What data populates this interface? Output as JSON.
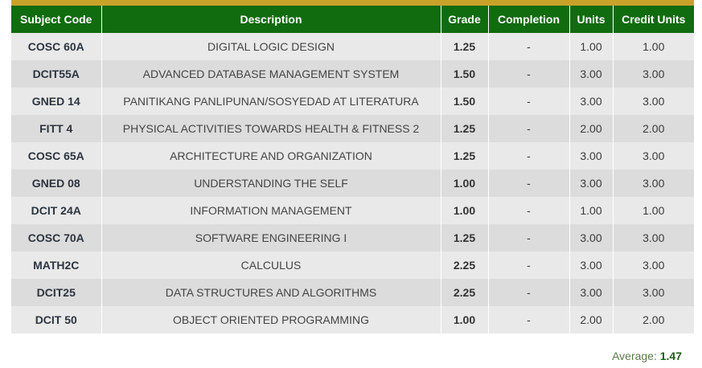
{
  "table": {
    "headers": {
      "subject_code": "Subject Code",
      "description": "Description",
      "grade": "Grade",
      "completion": "Completion",
      "units": "Units",
      "credit_units": "Credit Units"
    },
    "rows": [
      {
        "code": "COSC 60A",
        "description": "DIGITAL LOGIC DESIGN",
        "grade": "1.25",
        "completion": "-",
        "units": "1.00",
        "credit_units": "1.00"
      },
      {
        "code": "DCIT55A",
        "description": "ADVANCED DATABASE MANAGEMENT SYSTEM",
        "grade": "1.50",
        "completion": "-",
        "units": "3.00",
        "credit_units": "3.00"
      },
      {
        "code": "GNED 14",
        "description": "PANITIKANG PANLIPUNAN/SOSYEDAD AT LITERATURA",
        "grade": "1.50",
        "completion": "-",
        "units": "3.00",
        "credit_units": "3.00"
      },
      {
        "code": "FITT 4",
        "description": "PHYSICAL ACTIVITIES TOWARDS HEALTH & FITNESS 2",
        "grade": "1.25",
        "completion": "-",
        "units": "2.00",
        "credit_units": "2.00"
      },
      {
        "code": "COSC 65A",
        "description": "ARCHITECTURE AND ORGANIZATION",
        "grade": "1.25",
        "completion": "-",
        "units": "3.00",
        "credit_units": "3.00"
      },
      {
        "code": "GNED 08",
        "description": "UNDERSTANDING THE SELF",
        "grade": "1.00",
        "completion": "-",
        "units": "3.00",
        "credit_units": "3.00"
      },
      {
        "code": "DCIT 24A",
        "description": "INFORMATION MANAGEMENT",
        "grade": "1.00",
        "completion": "-",
        "units": "1.00",
        "credit_units": "1.00"
      },
      {
        "code": "COSC 70A",
        "description": "SOFTWARE ENGINEERING I",
        "grade": "1.25",
        "completion": "-",
        "units": "3.00",
        "credit_units": "3.00"
      },
      {
        "code": "MATH2C",
        "description": "CALCULUS",
        "grade": "2.25",
        "completion": "-",
        "units": "3.00",
        "credit_units": "3.00"
      },
      {
        "code": "DCIT25",
        "description": "DATA STRUCTURES AND ALGORITHMS",
        "grade": "2.25",
        "completion": "-",
        "units": "3.00",
        "credit_units": "3.00"
      },
      {
        "code": "DCIT 50",
        "description": "OBJECT ORIENTED PROGRAMMING",
        "grade": "1.00",
        "completion": "-",
        "units": "2.00",
        "credit_units": "2.00"
      }
    ]
  },
  "average": {
    "label": "Average:",
    "value": "1.47"
  },
  "colors": {
    "header_bg": "#116b0f",
    "top_bar": "#c9a22a",
    "row_light": "#e9e9e9",
    "row_dark": "#dcdcdc"
  }
}
